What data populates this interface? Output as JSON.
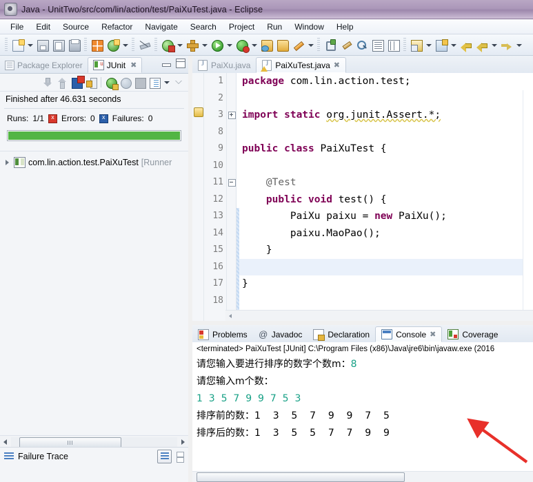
{
  "window": {
    "title": "Java - UnitTwo/src/com/lin/action/test/PaiXuTest.java - Eclipse",
    "app_icon": "eclipse-icon"
  },
  "menubar": {
    "items": [
      {
        "label": "File"
      },
      {
        "label": "Edit"
      },
      {
        "label": "Source"
      },
      {
        "label": "Refactor"
      },
      {
        "label": "Navigate"
      },
      {
        "label": "Search"
      },
      {
        "label": "Project"
      },
      {
        "label": "Run"
      },
      {
        "label": "Window"
      },
      {
        "label": "Help"
      }
    ]
  },
  "toolbar": {
    "buttons": [
      {
        "name": "new-icon",
        "type": "icon"
      },
      {
        "name": "new-dropdown-icon",
        "type": "arrow"
      },
      {
        "name": "save-icon",
        "type": "icon"
      },
      {
        "name": "save-all-icon",
        "type": "icon"
      },
      {
        "name": "print-icon",
        "type": "icon"
      },
      {
        "name": "build-all-icon",
        "type": "icon"
      },
      {
        "name": "new-java-class-icon",
        "type": "icon"
      },
      {
        "name": "new-java-dropdown-icon",
        "type": "arrow"
      },
      {
        "name": "skip-breakpoints-icon",
        "type": "icon"
      },
      {
        "name": "debug-icon",
        "type": "icon"
      },
      {
        "name": "debug-dropdown-icon",
        "type": "arrow"
      },
      {
        "name": "external-tools-icon",
        "type": "icon"
      },
      {
        "name": "external-tools-dropdown-icon",
        "type": "arrow"
      },
      {
        "name": "run-icon",
        "type": "icon"
      },
      {
        "name": "run-dropdown-icon",
        "type": "arrow"
      },
      {
        "name": "coverage-icon",
        "type": "icon"
      },
      {
        "name": "coverage-dropdown-icon",
        "type": "arrow"
      },
      {
        "name": "open-type-icon",
        "type": "icon"
      },
      {
        "name": "open-task-icon",
        "type": "icon"
      },
      {
        "name": "new-annotation-icon",
        "type": "icon"
      },
      {
        "name": "annotation-dropdown-icon",
        "type": "arrow"
      },
      {
        "name": "next-marker-icon",
        "type": "icon"
      },
      {
        "name": "previous-edit-icon",
        "type": "icon"
      },
      {
        "name": "search-icon",
        "type": "icon"
      },
      {
        "name": "toggle-block-selection-icon",
        "type": "icon"
      },
      {
        "name": "toggle-word-wrap-icon",
        "type": "icon"
      },
      {
        "name": "show-whitespace-icon",
        "type": "icon"
      },
      {
        "name": "whitespace-dropdown-icon",
        "type": "arrow"
      },
      {
        "name": "open-perspective-icon",
        "type": "icon"
      },
      {
        "name": "perspective-dropdown-icon",
        "type": "arrow"
      },
      {
        "name": "back-history-icon",
        "type": "icon"
      },
      {
        "name": "back-icon",
        "type": "icon"
      },
      {
        "name": "back-dropdown-icon",
        "type": "arrow"
      },
      {
        "name": "forward-icon",
        "type": "icon"
      },
      {
        "name": "forward-dropdown-icon",
        "type": "arrow"
      }
    ]
  },
  "left_panel": {
    "tabs": [
      {
        "label": "Package Explorer",
        "active": false,
        "icon": "package-explorer-icon"
      },
      {
        "label": "JUnit",
        "active": true,
        "icon": "junit-icon",
        "closeable": true
      }
    ],
    "junit_toolbar": [
      {
        "name": "next-failure-icon"
      },
      {
        "name": "previous-failure-icon"
      },
      {
        "name": "show-failures-only-icon"
      },
      {
        "name": "lock-scroll-icon"
      },
      {
        "name": "rerun-test-icon"
      },
      {
        "name": "rerun-failed-tests-icon"
      },
      {
        "name": "stop-test-icon"
      },
      {
        "name": "test-run-history-icon"
      },
      {
        "name": "view-menu-icon"
      },
      {
        "name": "minimize-view-icon"
      }
    ],
    "status_text": "Finished after 46.631 seconds",
    "stats": {
      "runs_label": "Runs:",
      "runs_value": "1/1",
      "errors_label": "Errors:",
      "errors_value": "0",
      "failures_label": "Failures:",
      "failures_value": "0"
    },
    "progress": {
      "percent": 100,
      "color": "#52b544"
    },
    "tree": [
      {
        "label": "com.lin.action.test.PaiXuTest",
        "suffix": "[Runner",
        "expanded": false,
        "icon": "test-class-icon"
      }
    ],
    "failure_trace": {
      "label": "Failure Trace",
      "icon": "failure-trace-icon",
      "tools": [
        {
          "name": "filter-stack-trace-icon"
        },
        {
          "name": "compare-result-icon"
        }
      ]
    }
  },
  "editor": {
    "tabs": [
      {
        "label": "PaiXu.java",
        "active": false,
        "icon": "java-file-icon"
      },
      {
        "label": "PaiXuTest.java",
        "active": true,
        "icon": "java-file-warning-icon",
        "closeable": true
      }
    ],
    "lines": [
      {
        "num": "1",
        "fold": "",
        "current": false,
        "segments": [
          {
            "text": "package ",
            "style": "kw"
          },
          {
            "text": "com.lin.action.test;",
            "style": "plain"
          }
        ]
      },
      {
        "num": "2",
        "fold": "",
        "current": false,
        "segments": []
      },
      {
        "num": "3",
        "fold": "plus",
        "current": false,
        "marker": "warning",
        "segments": [
          {
            "text": "import static ",
            "style": "kw"
          },
          {
            "text": "org.junit.Assert.*;",
            "style": "warn"
          }
        ]
      },
      {
        "num": "8",
        "fold": "",
        "current": false,
        "segments": []
      },
      {
        "num": "9",
        "fold": "",
        "current": false,
        "segments": [
          {
            "text": "public class ",
            "style": "kw"
          },
          {
            "text": "PaiXuTest {",
            "style": "plain"
          }
        ]
      },
      {
        "num": "10",
        "fold": "",
        "current": false,
        "segments": []
      },
      {
        "num": "11",
        "fold": "minus",
        "current": false,
        "segments": [
          {
            "text": "    @Test",
            "style": "ann"
          }
        ]
      },
      {
        "num": "12",
        "fold": "",
        "current": false,
        "segments": [
          {
            "text": "    ",
            "style": "plain"
          },
          {
            "text": "public void ",
            "style": "kw"
          },
          {
            "text": "test() {",
            "style": "plain"
          }
        ]
      },
      {
        "num": "13",
        "fold": "",
        "current": false,
        "segments": [
          {
            "text": "        PaiXu paixu = ",
            "style": "plain"
          },
          {
            "text": "new ",
            "style": "kw"
          },
          {
            "text": "PaiXu();",
            "style": "plain"
          }
        ]
      },
      {
        "num": "14",
        "fold": "",
        "current": false,
        "segments": [
          {
            "text": "        paixu.MaoPao();",
            "style": "plain"
          }
        ]
      },
      {
        "num": "15",
        "fold": "",
        "current": false,
        "segments": [
          {
            "text": "    }",
            "style": "plain"
          }
        ]
      },
      {
        "num": "16",
        "fold": "",
        "current": true,
        "segments": []
      },
      {
        "num": "17",
        "fold": "",
        "current": false,
        "segments": [
          {
            "text": "}",
            "style": "plain"
          }
        ]
      },
      {
        "num": "18",
        "fold": "",
        "current": false,
        "segments": []
      }
    ]
  },
  "console_panel": {
    "tabs": [
      {
        "label": "Problems",
        "active": false,
        "icon": "problems-icon"
      },
      {
        "label": "Javadoc",
        "active": false,
        "icon": "javadoc-icon"
      },
      {
        "label": "Declaration",
        "active": false,
        "icon": "declaration-icon"
      },
      {
        "label": "Console",
        "active": true,
        "icon": "console-icon",
        "closeable": true
      },
      {
        "label": "Coverage",
        "active": false,
        "icon": "coverage-icon"
      }
    ],
    "terminated_line": "<terminated> PaiXuTest [JUnit] C:\\Program Files (x86)\\Java\\jre6\\bin\\javaw.exe (2016",
    "output": [
      {
        "type": "mixed",
        "parts": [
          {
            "text": "请您输入要进行排序的数字个数m：",
            "style": "out"
          },
          {
            "text": "8",
            "style": "in"
          }
        ]
      },
      {
        "type": "mixed",
        "parts": [
          {
            "text": "请您输入m个数：",
            "style": "out"
          }
        ]
      },
      {
        "type": "mixed",
        "parts": [
          {
            "text": "1  3  5  7  9  9  7  5  3",
            "style": "in"
          }
        ]
      },
      {
        "type": "mixed",
        "parts": [
          {
            "text": "排序前的数：1    3    5    7    9    9    7    5",
            "style": "out"
          }
        ]
      },
      {
        "type": "mixed",
        "parts": [
          {
            "text": "排序后的数：1    3    5    5    7    7    9    9",
            "style": "out"
          }
        ]
      }
    ]
  },
  "annotation": {
    "arrow_color": "#e8302a",
    "name": "red-pointer-arrow"
  },
  "colors": {
    "title_bar": "#a894b6",
    "keyword": "#7f0055",
    "console_input": "#16a085",
    "progress_green": "#52b544"
  }
}
